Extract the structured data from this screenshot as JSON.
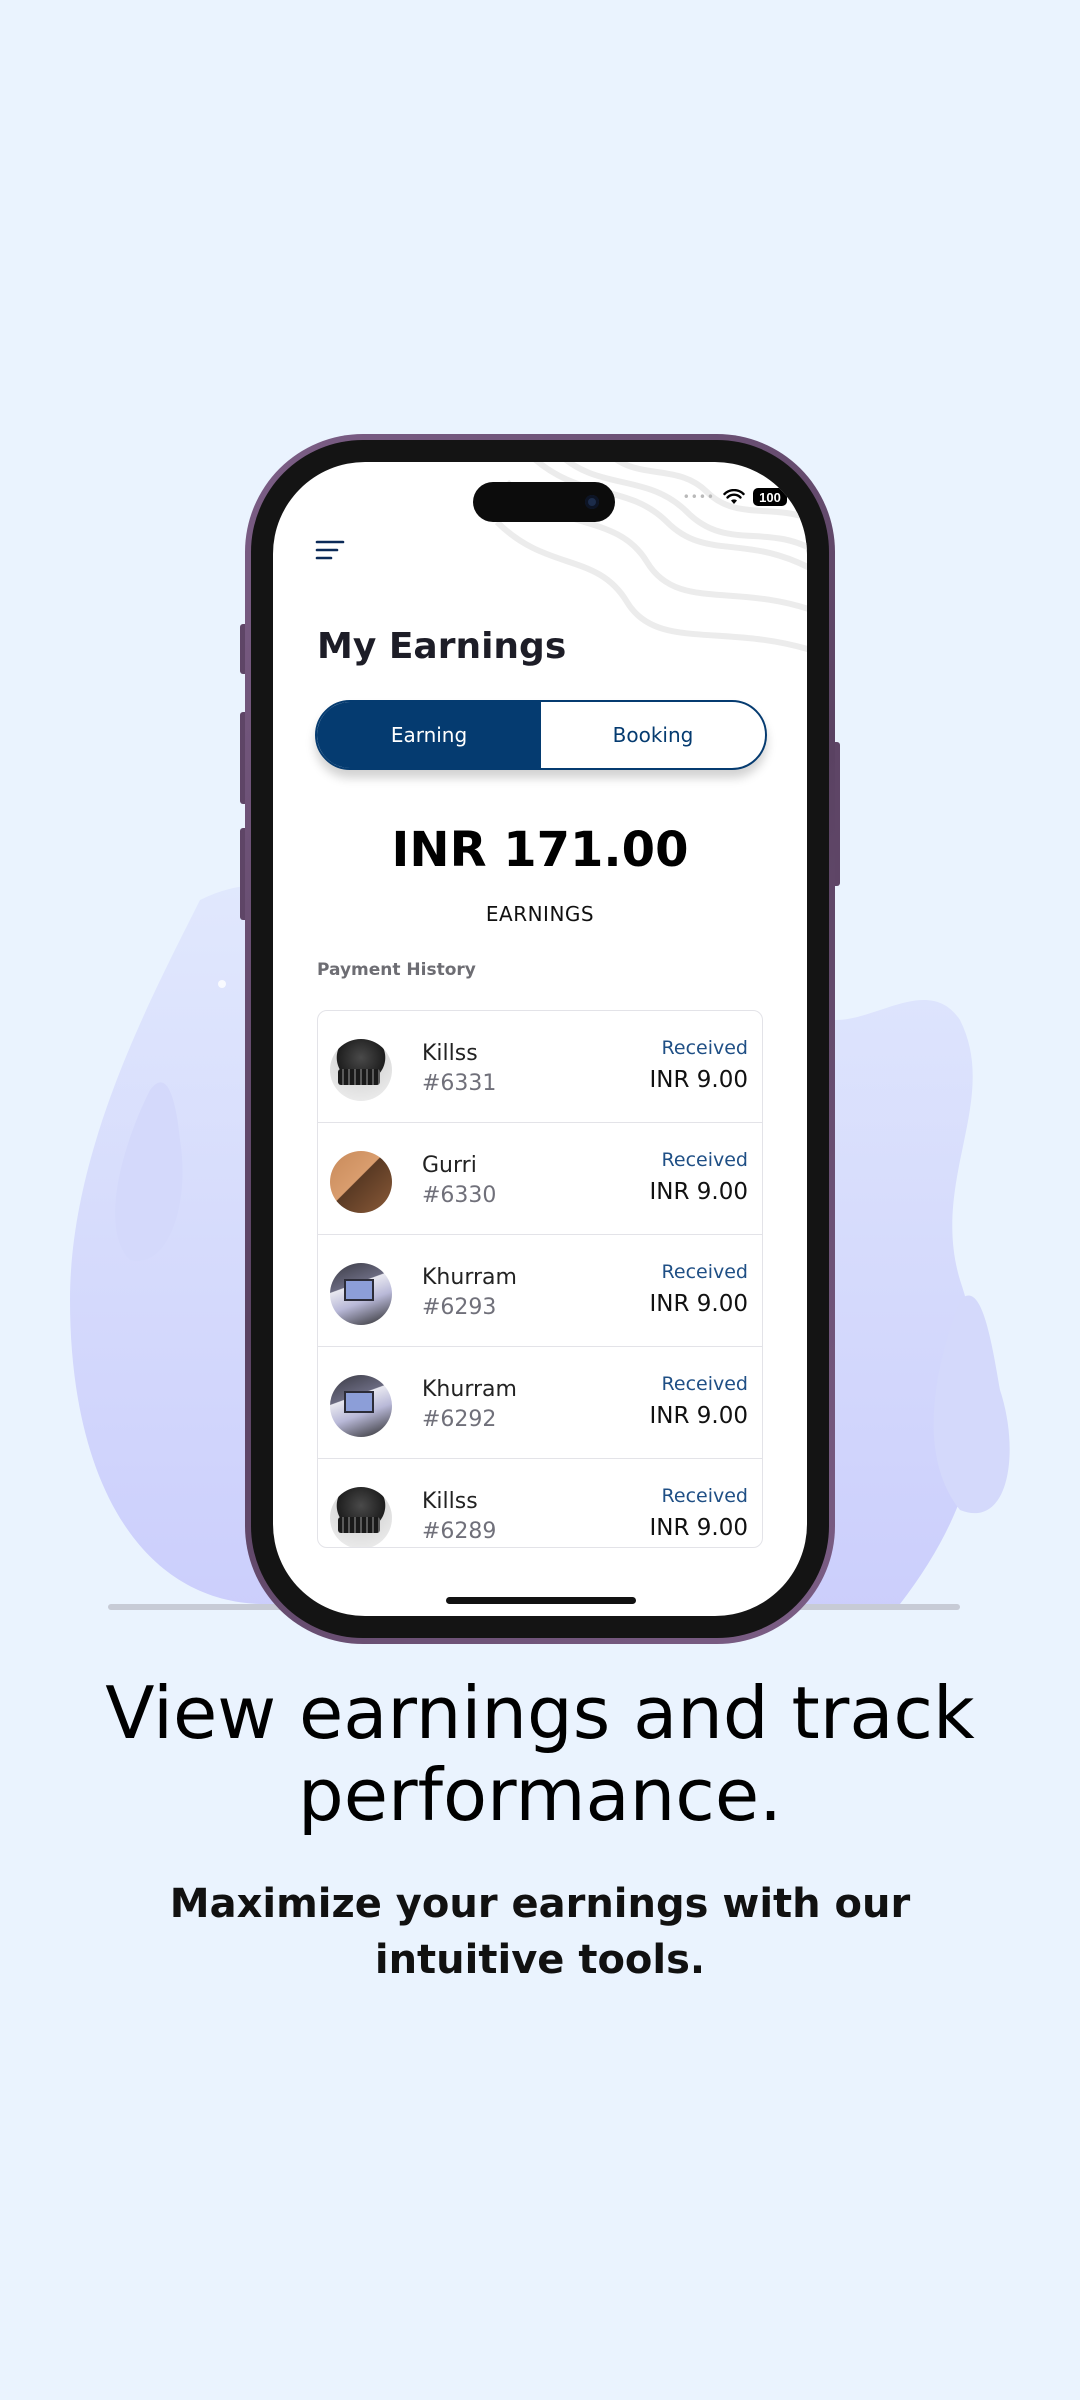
{
  "status_bar": {
    "battery": "100"
  },
  "header": {
    "title": "My Earnings"
  },
  "tabs": [
    {
      "label": "Earning",
      "active": true
    },
    {
      "label": "Booking",
      "active": false
    }
  ],
  "summary": {
    "amount": "INR 171.00",
    "label": "EARNINGS"
  },
  "history": {
    "title": "Payment History",
    "items": [
      {
        "name": "Killss",
        "id": "#6331",
        "status": "Received",
        "amount": "INR 9.00",
        "avatar": "keyboard"
      },
      {
        "name": "Gurri",
        "id": "#6330",
        "status": "Received",
        "amount": "INR 9.00",
        "avatar": "wood"
      },
      {
        "name": "Khurram",
        "id": "#6293",
        "status": "Received",
        "amount": "INR 9.00",
        "avatar": "desk"
      },
      {
        "name": "Khurram",
        "id": "#6292",
        "status": "Received",
        "amount": "INR 9.00",
        "avatar": "desk"
      },
      {
        "name": "Killss",
        "id": "#6289",
        "status": "Received",
        "amount": "INR 9.00",
        "avatar": "keyboard"
      }
    ]
  },
  "promo": {
    "headline": "View earnings and track performance.",
    "subline": "Maximize your earnings with our intuitive tools."
  },
  "colors": {
    "background": "#eaf3fe",
    "primary": "#053b70",
    "status_text": "#1f4f85",
    "blob": "#ccd0fb",
    "phone_frame": "#6a4f74"
  }
}
